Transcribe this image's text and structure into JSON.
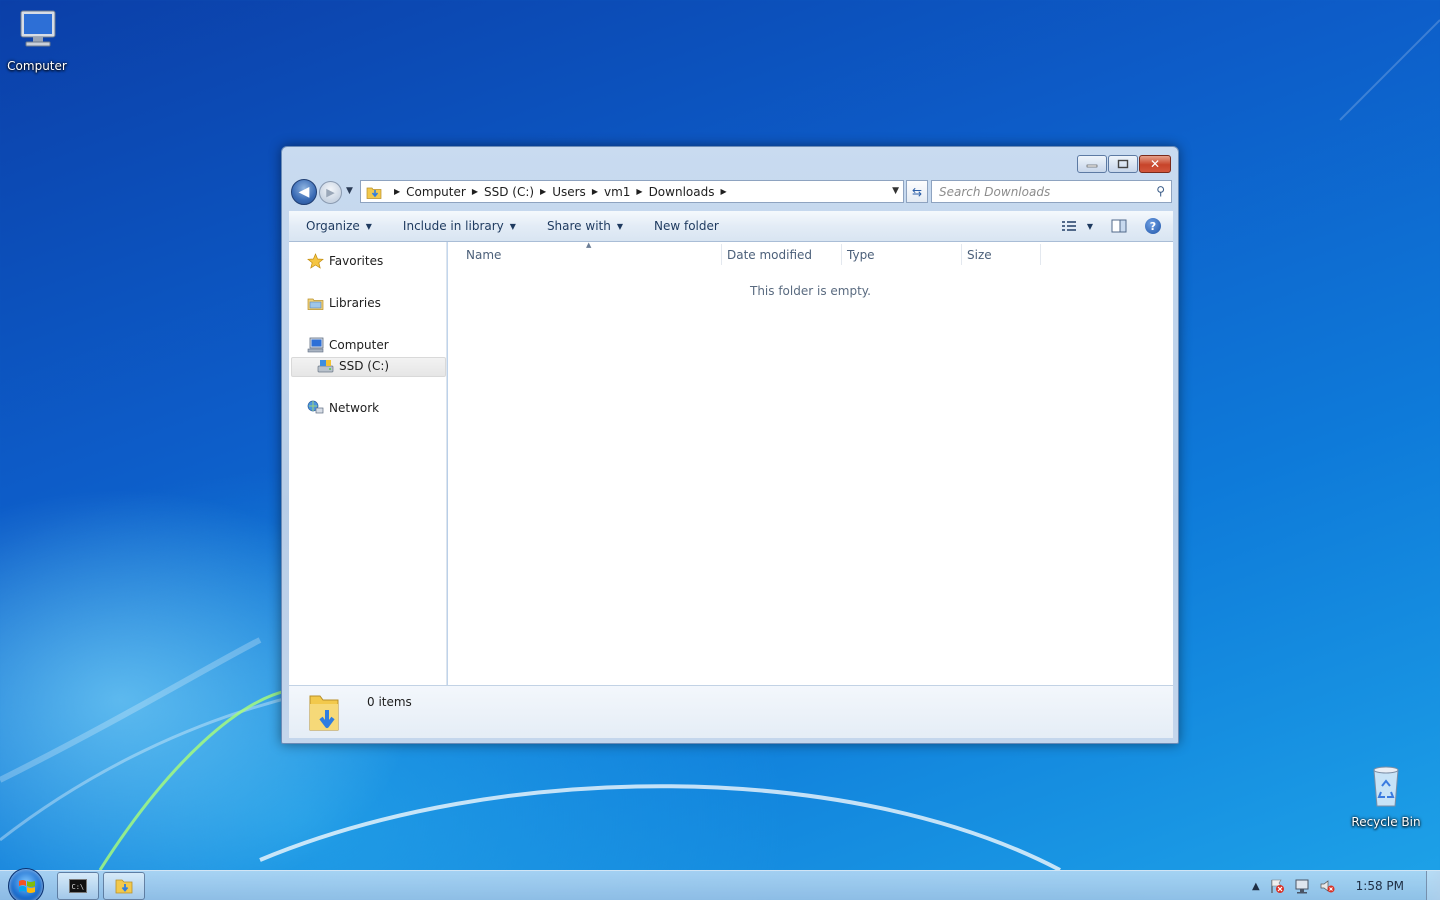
{
  "desktop": {
    "icons": [
      {
        "label": "Computer"
      },
      {
        "label": "Recycle Bin"
      }
    ]
  },
  "window": {
    "breadcrumb": [
      "Computer",
      "SSD (C:)",
      "Users",
      "vm1",
      "Downloads"
    ],
    "search_placeholder": "Search Downloads",
    "toolbar": {
      "organize": "Organize",
      "include_in_library": "Include in library",
      "share_with": "Share with",
      "new_folder": "New folder"
    },
    "nav_pane": {
      "favorites": "Favorites",
      "libraries": "Libraries",
      "computer": "Computer",
      "ssd": "SSD (C:)",
      "network": "Network"
    },
    "columns": [
      "Name",
      "Date modified",
      "Type",
      "Size"
    ],
    "empty_message": "This folder is empty.",
    "status": {
      "item_count": "0 items"
    }
  },
  "taskbar": {
    "clock": "1:58 PM"
  },
  "colors": {
    "accent": "#1f55a8",
    "close_button": "#c7442a",
    "desktop": "#0d5cc8"
  }
}
